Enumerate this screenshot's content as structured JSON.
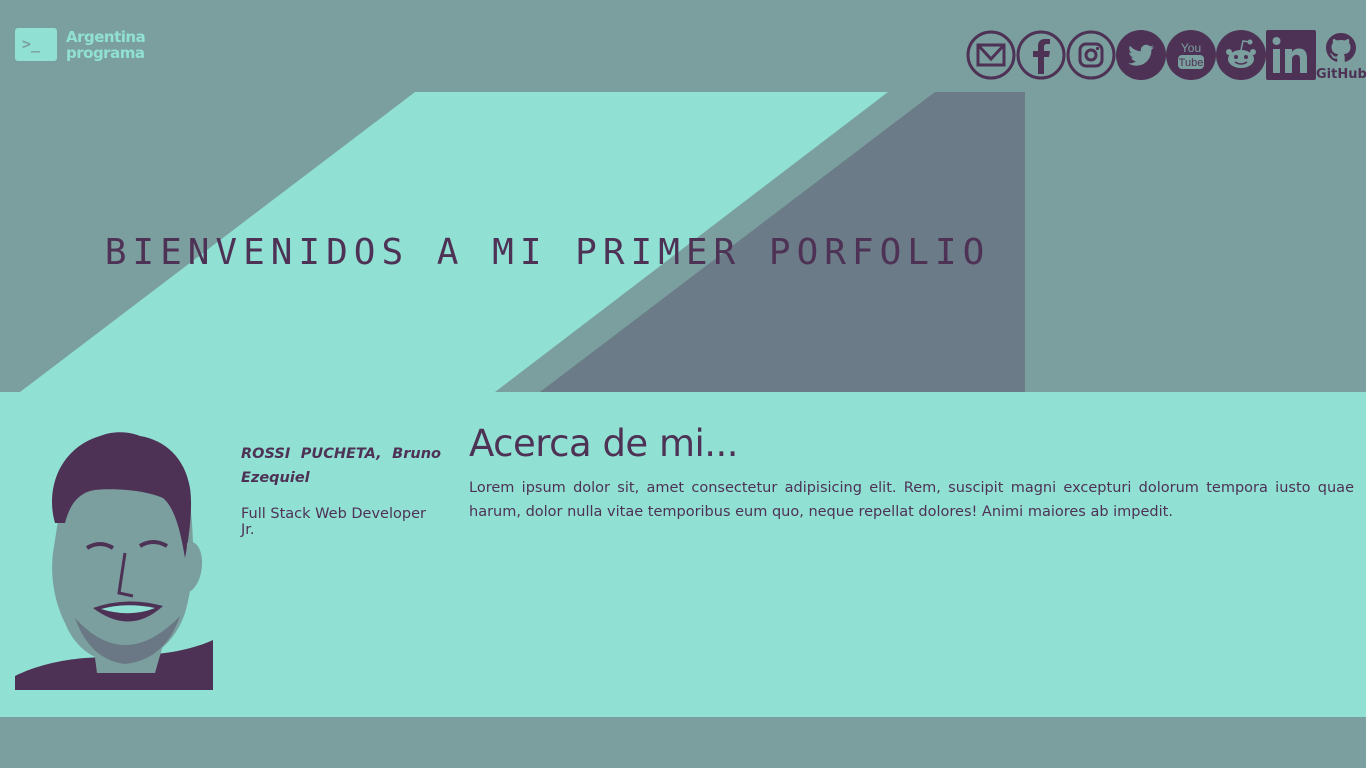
{
  "colors": {
    "background": "#7a9f9e",
    "mint": "#91e0d4",
    "purple": "#4e3255",
    "slate": "#6b7b87"
  },
  "header": {
    "logo_line1": "Argentina",
    "logo_line2": "programa",
    "logo_symbol": ">_",
    "social": [
      {
        "icon": "mail-icon",
        "label": ""
      },
      {
        "icon": "facebook-icon",
        "label": ""
      },
      {
        "icon": "instagram-icon",
        "label": ""
      },
      {
        "icon": "twitter-icon",
        "label": ""
      },
      {
        "icon": "youtube-icon",
        "label": "You Tube"
      },
      {
        "icon": "reddit-icon",
        "label": ""
      },
      {
        "icon": "linkedin-icon",
        "label": "in"
      },
      {
        "icon": "github-icon",
        "label": "GitHub"
      }
    ]
  },
  "hero": {
    "title": "BIENVENIDOS A MI PRIMER PORFOLIO"
  },
  "profile": {
    "name": "ROSSI PUCHETA, Bruno Ezequiel",
    "role": "Full Stack Web Developer Jr."
  },
  "about": {
    "title": "Acerca de mi...",
    "text": "Lorem ipsum dolor sit, amet consectetur adipisicing elit. Rem, suscipit magni excepturi dolorum tempora iusto quae harum, dolor nulla vitae temporibus eum quo, neque repellat dolores! Animi maiores ab impedit."
  }
}
